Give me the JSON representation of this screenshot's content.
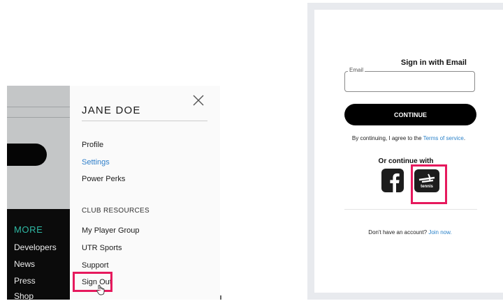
{
  "sidebar": {
    "heading": "MORE",
    "links": [
      "Developers",
      "News",
      "Press",
      "Shop"
    ]
  },
  "drawer": {
    "user_name": "JANE DOE",
    "close_icon": "close-x-icon",
    "items": [
      "Profile",
      "Settings",
      "Power Perks"
    ],
    "section_label": "CLUB RESOURCES",
    "section_items": [
      "My Player Group",
      "UTR Sports",
      "Support"
    ],
    "sign_out": "Sign Out"
  },
  "signin": {
    "title": "Sign in with Email",
    "email_label": "Email",
    "email_value": "",
    "continue_label": "CONTINUE",
    "agree_prefix": "By continuing, I agree to the ",
    "terms_link": "Terms of service",
    "agree_suffix": ".",
    "or_continue": "Or continue with",
    "social": [
      "facebook-icon",
      "tennis-icon"
    ],
    "tennis_logo_text": "tennis",
    "no_account_prefix": "Don't have an account? ",
    "join_link": "Join now."
  },
  "colors": {
    "accent_teal": "#2fb9a4",
    "link_blue": "#2b82c9",
    "highlight_pink": "#e6195d"
  }
}
